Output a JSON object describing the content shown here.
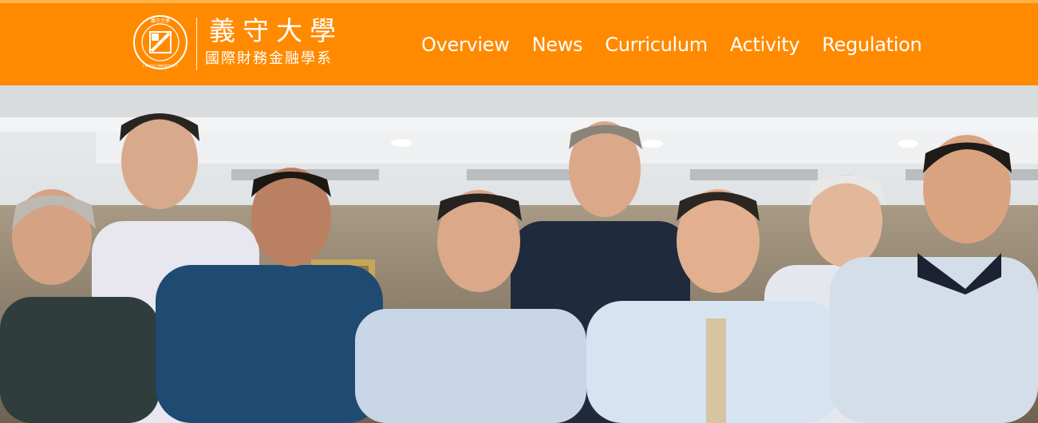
{
  "header": {
    "logo_title": "義守大學",
    "logo_subtitle": "國際財務金融學系",
    "seal_text": "I-SHOU UNIVERSITY",
    "seal_top": "義守大學",
    "bg_color": "#ff8a00",
    "text_color": "#ffffff"
  },
  "nav": {
    "items": [
      {
        "label": "Overview",
        "name": "nav-overview"
      },
      {
        "label": "News",
        "name": "nav-news"
      },
      {
        "label": "Curriculum",
        "name": "nav-curriculum"
      },
      {
        "label": "Activity",
        "name": "nav-activity"
      },
      {
        "label": "Regulation",
        "name": "nav-regulation"
      }
    ]
  },
  "hero": {
    "image": "group-photo-faculty"
  }
}
